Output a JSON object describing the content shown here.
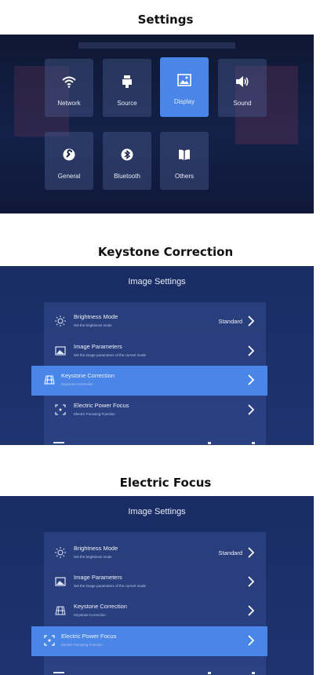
{
  "sections": {
    "settings_title": "Settings",
    "keystone_title": "Keystone Correction",
    "focus_title": "Electric Focus"
  },
  "settings_menu": {
    "tiles": [
      {
        "label": "Network",
        "icon": "wifi-icon"
      },
      {
        "label": "Source",
        "icon": "source-icon"
      },
      {
        "label": "Display",
        "icon": "display-icon",
        "selected": true
      },
      {
        "label": "Sound",
        "icon": "speaker-icon"
      },
      {
        "label": "General",
        "icon": "wrench-icon"
      },
      {
        "label": "Bluetooth",
        "icon": "bluetooth-icon"
      },
      {
        "label": "Others",
        "icon": "book-icon"
      }
    ]
  },
  "image_settings_keystone": {
    "title": "Image Settings",
    "rows": [
      {
        "label": "Brightness Mode",
        "sub": "Set the brightness mode",
        "value": "Standard"
      },
      {
        "label": "Image Parameters",
        "sub": "Set the image parameters of the current mode"
      },
      {
        "label": "Keystone Correction",
        "sub": "Keystone Correction",
        "selected": true
      },
      {
        "label": "Electric Power Focus",
        "sub": "Electric Focusing Function"
      }
    ]
  },
  "image_settings_focus": {
    "title": "Image Settings",
    "rows": [
      {
        "label": "Brightness Mode",
        "sub": "Set the brightness mode",
        "value": "Standard"
      },
      {
        "label": "Image Parameters",
        "sub": "Set the image parameters of the current mode"
      },
      {
        "label": "Keystone Correction",
        "sub": "Keystone Correction"
      },
      {
        "label": "Electric Power Focus",
        "sub": "Electric Focusing Function",
        "selected": true
      }
    ]
  },
  "colors": {
    "accent": "#4a86e8",
    "panel_dark": "#0e1733",
    "panel_blue": "#1e3370"
  }
}
